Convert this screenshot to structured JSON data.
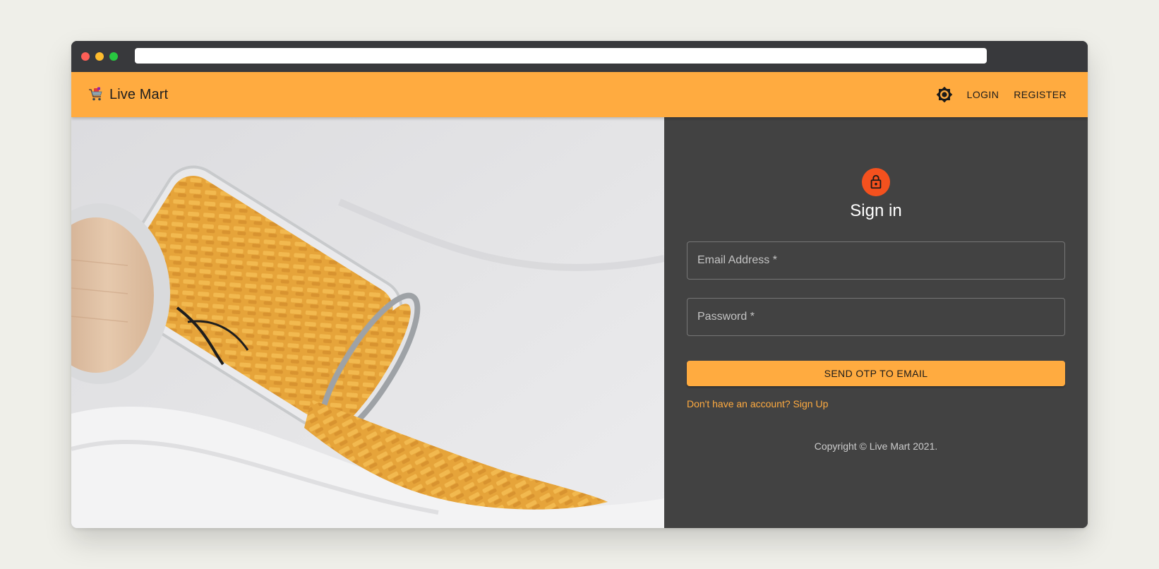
{
  "appbar": {
    "brand_name": "Live Mart",
    "brand_icon": "shopping-cart-icon",
    "theme_icon": "brightness-icon",
    "nav": {
      "login": "LOGIN",
      "register": "REGISTER"
    },
    "accent_color": "#ffab40"
  },
  "signin": {
    "icon": "lock-icon",
    "title": "Sign in",
    "email_label": "Email Address *",
    "password_label": "Password *",
    "submit_label": "SEND OTP TO EMAIL",
    "signup_link": "Don't have an account? Sign Up",
    "copyright": "Copyright © Live Mart 2021."
  },
  "colors": {
    "panel_bg": "#424242",
    "avatar_bg": "#f4511e",
    "link": "#ffab40"
  }
}
